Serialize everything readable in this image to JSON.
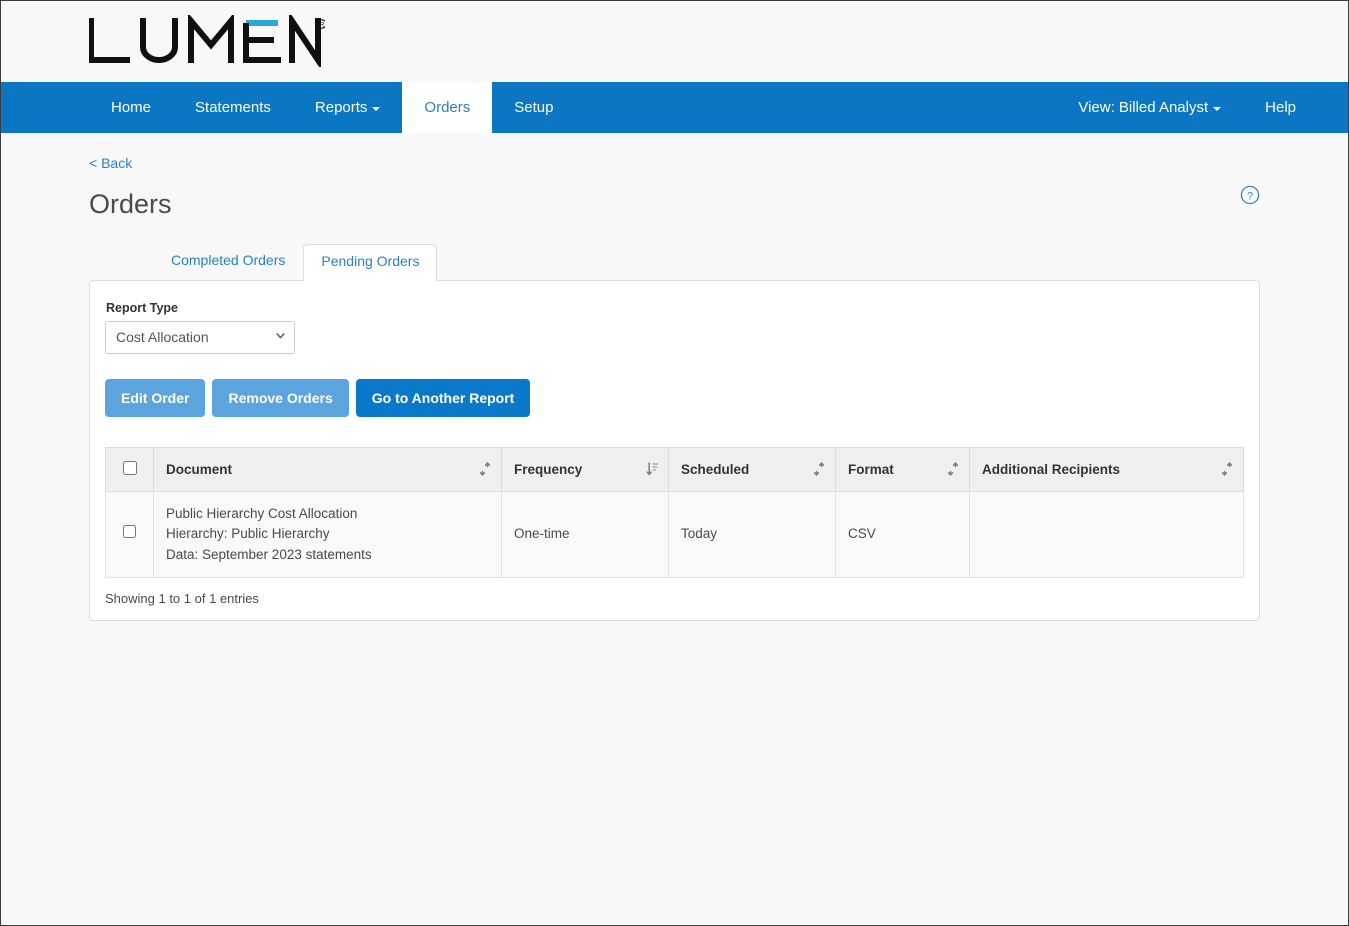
{
  "brand": {
    "logo_text": "LUMEN",
    "logo_trademark": "®",
    "accent_color": "#29a8e0"
  },
  "navbar": {
    "background_color": "#0b76c4",
    "left_items": [
      {
        "label": "Home",
        "active": false,
        "has_caret": false
      },
      {
        "label": "Statements",
        "active": false,
        "has_caret": false
      },
      {
        "label": "Reports",
        "active": false,
        "has_caret": true
      },
      {
        "label": "Orders",
        "active": true,
        "has_caret": false
      },
      {
        "label": "Setup",
        "active": false,
        "has_caret": false
      }
    ],
    "right_items": [
      {
        "label": "View: Billed Analyst",
        "has_caret": true
      },
      {
        "label": "Help",
        "has_caret": false
      }
    ]
  },
  "page": {
    "back_label": "< Back",
    "title": "Orders",
    "help_icon": "question-circle-icon"
  },
  "tabs": [
    {
      "label": "Completed Orders",
      "active": false
    },
    {
      "label": "Pending Orders",
      "active": true
    }
  ],
  "filters": {
    "report_type_label": "Report Type",
    "report_type_value": "Cost Allocation",
    "report_type_options": [
      "Cost Allocation"
    ]
  },
  "buttons": {
    "edit_order": "Edit Order",
    "remove_orders": "Remove Orders",
    "go_to_another_report": "Go to Another Report",
    "light_color": "#5ba4dd",
    "primary_color": "#0b79c9"
  },
  "table": {
    "columns": [
      {
        "label": "Document",
        "sort_icon": "sort-both-icon"
      },
      {
        "label": "Frequency",
        "sort_icon": "sort-desc-icon"
      },
      {
        "label": "Scheduled",
        "sort_icon": "sort-both-icon"
      },
      {
        "label": "Format",
        "sort_icon": "sort-both-icon"
      },
      {
        "label": "Additional Recipients",
        "sort_icon": "sort-both-icon"
      }
    ],
    "rows": [
      {
        "document_lines": [
          "Public Hierarchy Cost Allocation",
          "Hierarchy: Public Hierarchy",
          "Data: September 2023 statements"
        ],
        "frequency": "One-time",
        "scheduled": "Today",
        "format": "CSV",
        "additional_recipients": ""
      }
    ],
    "footer": "Showing 1 to 1 of 1 entries"
  }
}
